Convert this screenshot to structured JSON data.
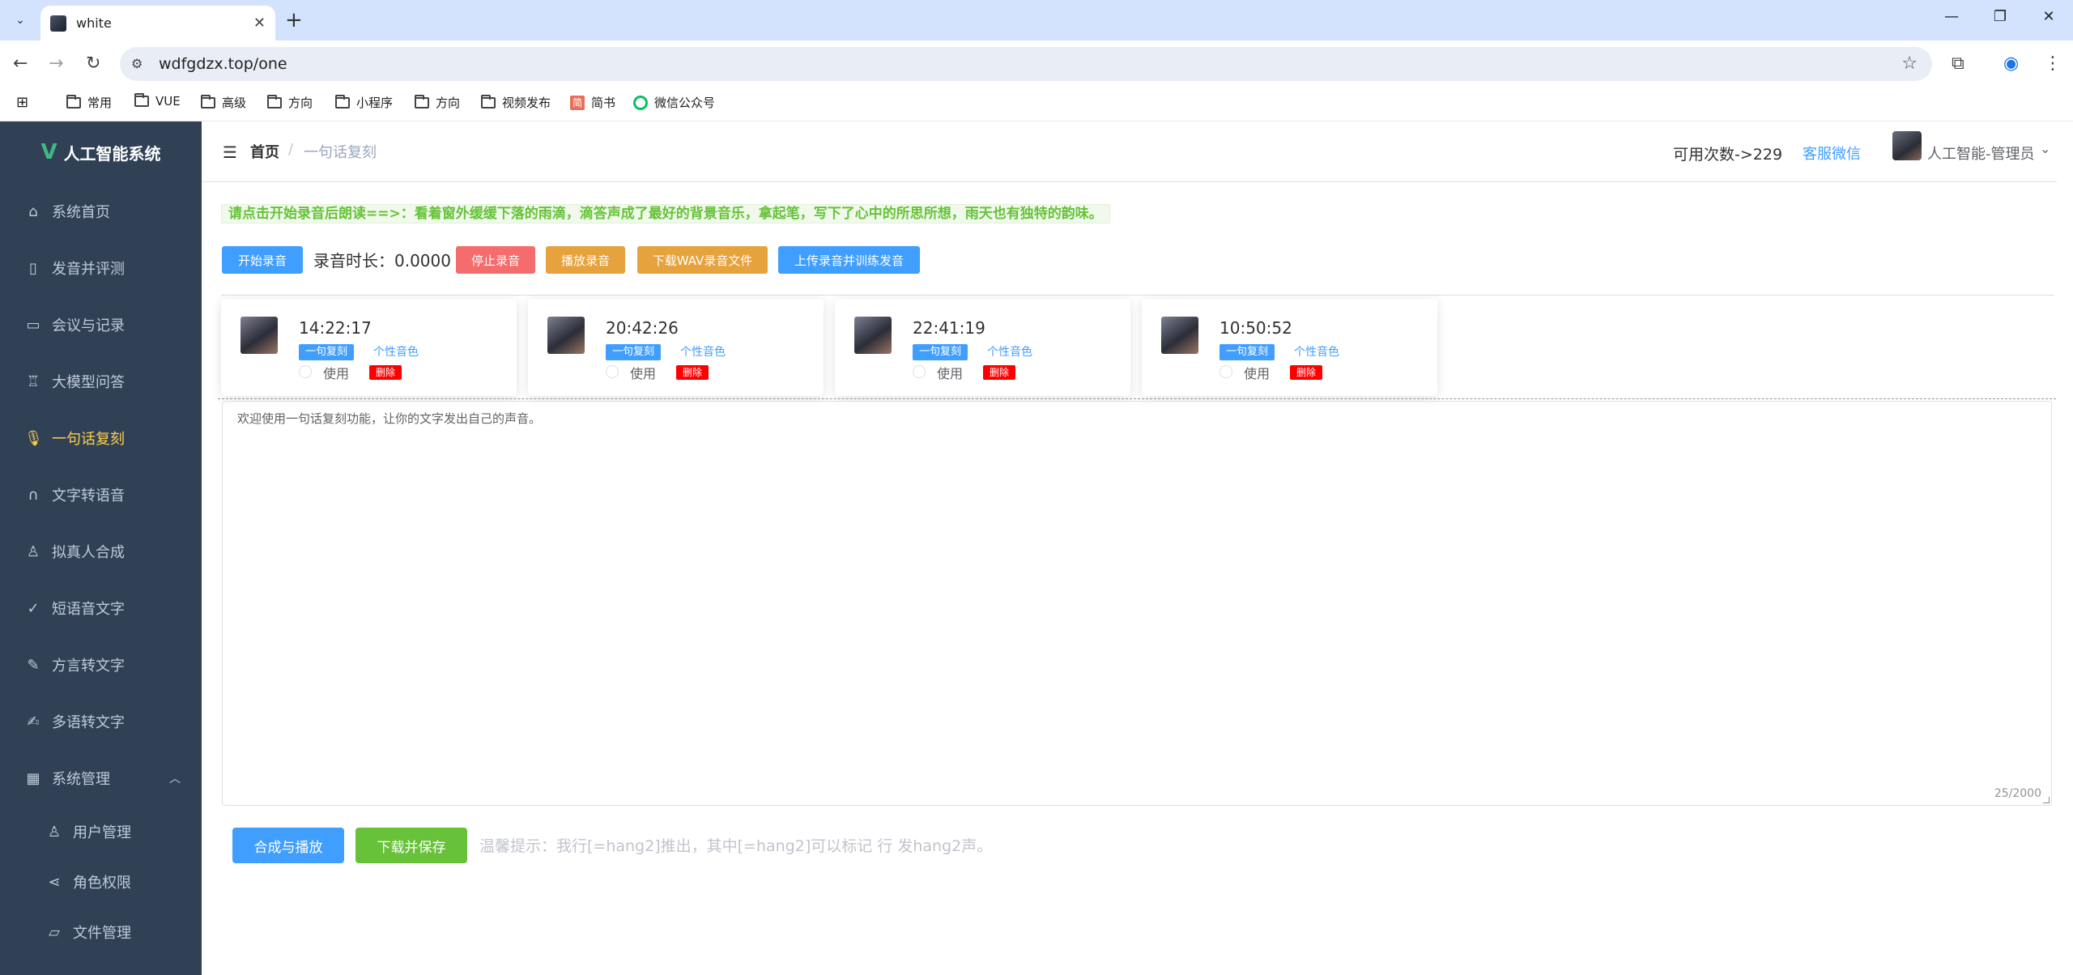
{
  "browser": {
    "tab_title": "white",
    "url": "wdfgdzx.top/one",
    "bookmarks": [
      "常用",
      "VUE",
      "高级",
      "方向",
      "小程序",
      "方向",
      "视频发布",
      "简书",
      "微信公众号"
    ]
  },
  "sidebar": {
    "logo_text": "人工智能系统",
    "items": [
      {
        "label": "系统首页",
        "icon": "home-icon"
      },
      {
        "label": "发音并评测",
        "icon": "book-icon"
      },
      {
        "label": "会议与记录",
        "icon": "monitor-icon"
      },
      {
        "label": "大模型问答",
        "icon": "cup-icon"
      },
      {
        "label": "一句话复刻",
        "icon": "microphone-icon"
      },
      {
        "label": "文字转语音",
        "icon": "headset-icon"
      },
      {
        "label": "拟真人合成",
        "icon": "user-icon"
      },
      {
        "label": "短语音文字",
        "icon": "checklist-icon"
      },
      {
        "label": "方言转文字",
        "icon": "pen-icon"
      },
      {
        "label": "多语转文字",
        "icon": "edit-icon"
      },
      {
        "label": "系统管理",
        "icon": "grid-icon"
      },
      {
        "label": "用户管理",
        "icon": "user-icon"
      },
      {
        "label": "角色权限",
        "icon": "share-icon"
      },
      {
        "label": "文件管理",
        "icon": "folder-icon"
      }
    ]
  },
  "navbar": {
    "breadcrumb_home": "首页",
    "breadcrumb_sep": "/",
    "breadcrumb_current": "一句话复刻",
    "quota": "可用次数->229",
    "service": "客服微信",
    "user": "人工智能-管理员"
  },
  "tip": "请点击开始录音后朗读==>：看着窗外缓缓下落的雨滴，滴答声成了最好的背景音乐，拿起笔，写下了心中的所思所想，雨天也有独特的韵味。",
  "toolbar": {
    "start": "开始录音",
    "duration_label": "录音时长：0.0000",
    "stop": "停止录音",
    "play": "播放录音",
    "download_wav": "下载WAV录音文件",
    "upload": "上传录音并训练发音"
  },
  "cards": [
    {
      "time": "14:22:17",
      "tag": "一句复刻",
      "link": "个性音色",
      "use": "使用",
      "delete": "删除"
    },
    {
      "time": "20:42:26",
      "tag": "一句复刻",
      "link": "个性音色",
      "use": "使用",
      "delete": "删除"
    },
    {
      "time": "22:41:19",
      "tag": "一句复刻",
      "link": "个性音色",
      "use": "使用",
      "delete": "删除"
    },
    {
      "time": "10:50:52",
      "tag": "一句复刻",
      "link": "个性音色",
      "use": "使用",
      "delete": "删除"
    }
  ],
  "editor": {
    "text": "欢迎使用一句话复刻功能，让你的文字发出自己的声音。",
    "counter": "25/2000"
  },
  "actions": {
    "synth": "合成与播放",
    "download": "下载并保存",
    "hint": "温馨提示：我行[=hang2]推出，其中[=hang2]可以标记 行 发hang2声。"
  }
}
